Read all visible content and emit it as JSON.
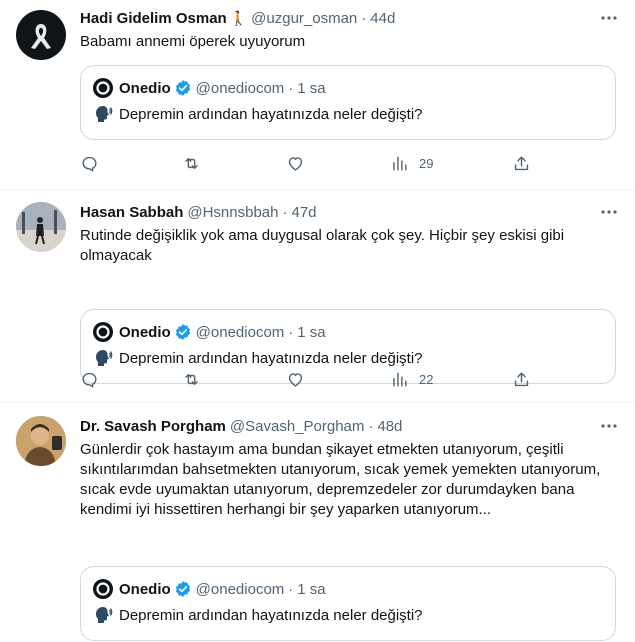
{
  "tweets": [
    {
      "name": "Hadi Gidelim Osman",
      "name_emoji": "🚶",
      "handle": "@uzgur_osman",
      "time": "44d",
      "text": "Babamı annemi öperek uyuyorum",
      "views": "29",
      "quote": {
        "name": "Onedio",
        "handle": "@onediocom",
        "time": "1 sa",
        "text": "Depremin ardından hayatınızda neler değişti?"
      }
    },
    {
      "name": "Hasan Sabbah",
      "handle": "@Hsnnsbbah",
      "time": "47d",
      "text": "Rutinde değişiklik yok ama duygusal olarak çok şey. Hiçbir şey eskisi gibi olmayacak",
      "views": "22",
      "quote": {
        "name": "Onedio",
        "handle": "@onediocom",
        "time": "1 sa",
        "text": "Depremin ardından hayatınızda neler değişti?"
      }
    },
    {
      "name": "Dr. Savash Porgham",
      "handle": "@Savash_Porgham",
      "time": "48d",
      "text": "Günlerdir çok hastayım ama bundan şikayet etmekten utanıyorum, çeşitli sıkıntılarımdan bahsetmekten utanıyorum, sıcak yemek yemekten utanıyorum, sıcak evde uyumaktan utanıyorum, depremzedeler zor durumdayken bana kendimi iyi hissettiren herhangi bir şey yaparken utanıyorum...",
      "quote": {
        "name": "Onedio",
        "handle": "@onediocom",
        "time": "1 sa",
        "text": "Depremin ardından hayatınızda neler değişti?"
      }
    }
  ],
  "separator": "·",
  "colors": {
    "verified": "#1d9bf0",
    "secondary_text": "#536471",
    "border": "#cfd9de"
  }
}
